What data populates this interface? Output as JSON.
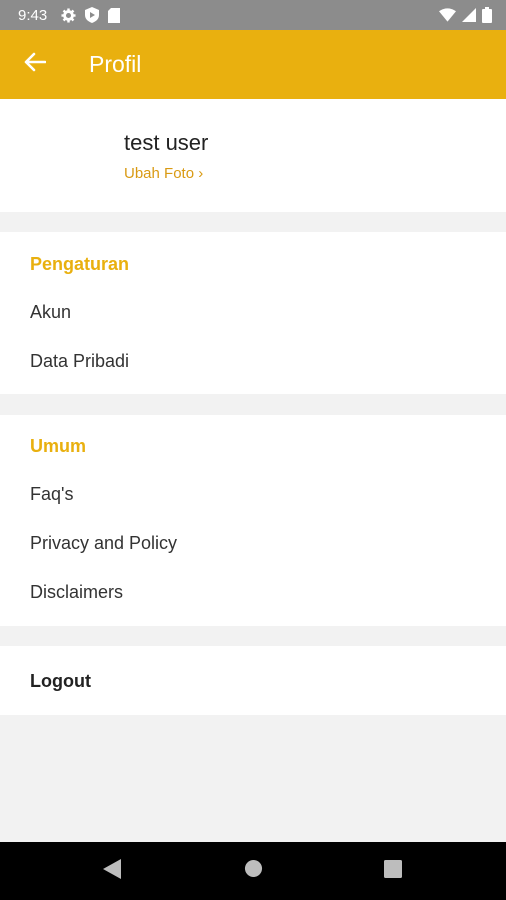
{
  "status_bar": {
    "time": "9:43",
    "left_icons": [
      "gear-icon",
      "shield-icon",
      "sd-card-icon"
    ],
    "right_icons": [
      "wifi-icon",
      "signal-icon",
      "battery-icon"
    ]
  },
  "app_bar": {
    "title": "Profil",
    "back_icon": "arrow-left-icon",
    "color": "#e9b00f"
  },
  "profile": {
    "name": "test user",
    "change_photo": "Ubah Foto ›"
  },
  "settings": {
    "header": "Pengaturan",
    "items": [
      {
        "label": "Akun"
      },
      {
        "label": "Data Pribadi"
      }
    ]
  },
  "general": {
    "header": "Umum",
    "items": [
      {
        "label": "Faq's"
      },
      {
        "label": "Privacy and Policy"
      },
      {
        "label": "Disclaimers"
      }
    ]
  },
  "logout": {
    "label": "Logout"
  },
  "nav_bar": {
    "buttons": [
      "back-triangle-icon",
      "home-circle-icon",
      "recents-square-icon"
    ]
  },
  "colors": {
    "accent": "#e9b00f",
    "link": "#d99a13",
    "background": "#f2f2f2"
  }
}
